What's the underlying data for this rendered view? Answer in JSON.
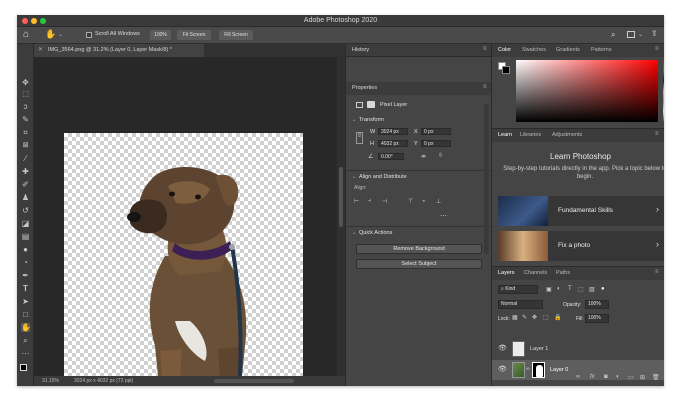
{
  "window": {
    "title": "Adobe Photoshop 2020"
  },
  "options_bar": {
    "scroll_all_windows": "Scroll All Windows",
    "zoom_100": "100%",
    "fit_screen": "Fit Screen",
    "fill_screen": "Fill Screen"
  },
  "document": {
    "tab_title": "IMG_3564.png @ 31.2% (Layer 0, Layer Mask/8) *",
    "zoom": "31.15%",
    "info": "3024 px x 4032 px (72 ppi)"
  },
  "mid_panel": {
    "tab_history": "History",
    "tab_properties": "Properties",
    "pixel_layer": "Pixel Layer",
    "transform_header": "Transform",
    "w_label": "W",
    "w_value": "3024 px",
    "h_label": "H",
    "h_value": "4032 px",
    "x_label": "X",
    "x_value": "0 px",
    "y_label": "Y",
    "y_value": "0 px",
    "angle_value": "0.00°",
    "align_header": "Align and Distribute",
    "align_label": "Align:",
    "quick_actions_header": "Quick Actions",
    "remove_bg": "Remove Background",
    "select_subject": "Select Subject"
  },
  "color_panel": {
    "tabs": [
      "Color",
      "Swatches",
      "Gradients",
      "Patterns"
    ],
    "hue_color": "#ff0000"
  },
  "learn_panel": {
    "tabs": [
      "Learn",
      "Libraries",
      "Adjustments"
    ],
    "heading": "Learn Photoshop",
    "description": "Step-by-step tutorials directly in the app. Pick a topic below to begin.",
    "cards": [
      {
        "label": "Fundamental Skills"
      },
      {
        "label": "Fix a photo"
      }
    ]
  },
  "layers_panel": {
    "tabs": [
      "Layers",
      "Channels",
      "Paths"
    ],
    "kind": "Kind",
    "blend_mode": "Normal",
    "opacity_label": "Opacity:",
    "opacity_value": "100%",
    "lock_label": "Lock:",
    "fill_label": "Fill:",
    "fill_value": "100%",
    "layers": [
      {
        "name": "Layer 1"
      },
      {
        "name": "Layer 0"
      }
    ]
  }
}
